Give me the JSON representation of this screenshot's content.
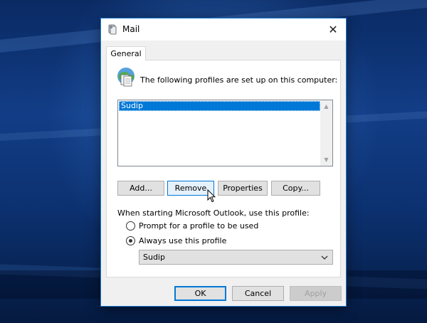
{
  "window": {
    "title": "Mail",
    "close_glyph": "✕"
  },
  "tabs": [
    {
      "label": "General"
    }
  ],
  "profiles": {
    "label": "The following profiles are set up on this computer:",
    "items": [
      "Sudip"
    ],
    "selected_index": 0
  },
  "buttons": {
    "add": "Add...",
    "remove": "Remove",
    "properties": "Properties",
    "copy": "Copy..."
  },
  "startup": {
    "label": "When starting Microsoft Outlook, use this profile:",
    "option_prompt": "Prompt for a profile to be used",
    "option_always": "Always use this profile",
    "selected_option": "always",
    "profile_select_value": "Sudip"
  },
  "footer": {
    "ok": "OK",
    "cancel": "Cancel",
    "apply": "Apply"
  },
  "colors": {
    "accent": "#0078d7",
    "window_border": "#1a7ccf",
    "dialog_bg": "#f0f0f0"
  },
  "icons": [
    "mail-app-icon",
    "close-icon",
    "profiles-icon",
    "scroll-up-icon",
    "scroll-down-icon",
    "chevron-down-icon",
    "mouse-cursor-icon"
  ]
}
